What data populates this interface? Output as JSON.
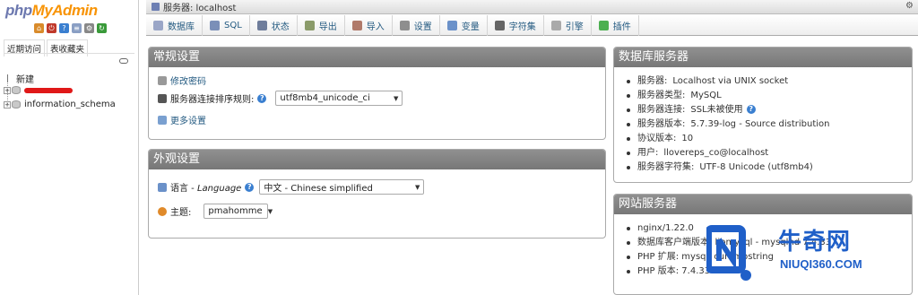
{
  "nav": {
    "logo_php": "php",
    "logo_my": "My",
    "logo_admin": "Admin",
    "tabs": [
      "近期访问",
      "表收藏夹"
    ],
    "tree": [
      {
        "label": "新建"
      },
      {
        "label": ""
      },
      {
        "label": "information_schema"
      }
    ]
  },
  "topbar": {
    "server_label": "服务器: localhost"
  },
  "menu": {
    "tabs": [
      {
        "label": "数据库",
        "icon": "database-icon"
      },
      {
        "label": "SQL",
        "icon": "sql-icon"
      },
      {
        "label": "状态",
        "icon": "status-icon"
      },
      {
        "label": "导出",
        "icon": "export-icon"
      },
      {
        "label": "导入",
        "icon": "import-icon"
      },
      {
        "label": "设置",
        "icon": "settings-icon"
      },
      {
        "label": "变量",
        "icon": "variables-icon"
      },
      {
        "label": "字符集",
        "icon": "charset-icon"
      },
      {
        "label": "引擎",
        "icon": "engine-icon"
      },
      {
        "label": "插件",
        "icon": "plugin-icon"
      }
    ]
  },
  "general": {
    "title": "常规设置",
    "change_password": "修改密码",
    "collation_label": "服务器连接排序规则:",
    "collation_value": "utf8mb4_unicode_ci",
    "more_settings": "更多设置"
  },
  "appearance": {
    "title": "外观设置",
    "language_label_cn": "语言 - ",
    "language_label_en": "Language",
    "language_value": "中文 - Chinese simplified",
    "theme_label": "主题:",
    "theme_value": "pmahomme"
  },
  "dbserver": {
    "title": "数据库服务器",
    "items": [
      {
        "k": "服务器:",
        "v": "Localhost via UNIX socket"
      },
      {
        "k": "服务器类型:",
        "v": "MySQL"
      },
      {
        "k": "服务器连接:",
        "v": "SSL未被使用"
      },
      {
        "k": "服务器版本:",
        "v": "5.7.39-log - Source distribution"
      },
      {
        "k": "协议版本:",
        "v": "10"
      },
      {
        "k": "用户:",
        "v": "llovereps_co@localhost"
      },
      {
        "k": "服务器字符集:",
        "v": "UTF-8 Unicode (utf8mb4)"
      }
    ]
  },
  "webserver": {
    "title": "网站服务器",
    "items": [
      {
        "text": "nginx/1.22.0"
      },
      {
        "text": "数据库客户端版本: libmysql - mysqlnd 7.4.33"
      },
      {
        "text": "PHP 扩展: mysqli curl mbstring"
      },
      {
        "text": "PHP 版本: 7.4.33"
      }
    ]
  },
  "watermark": {
    "cn": "牛奇网",
    "en": "NIUQI360.COM"
  },
  "colors": {
    "accent_link": "#235a81",
    "panel_header": "#808080",
    "watermark": "#1f5fc8"
  }
}
